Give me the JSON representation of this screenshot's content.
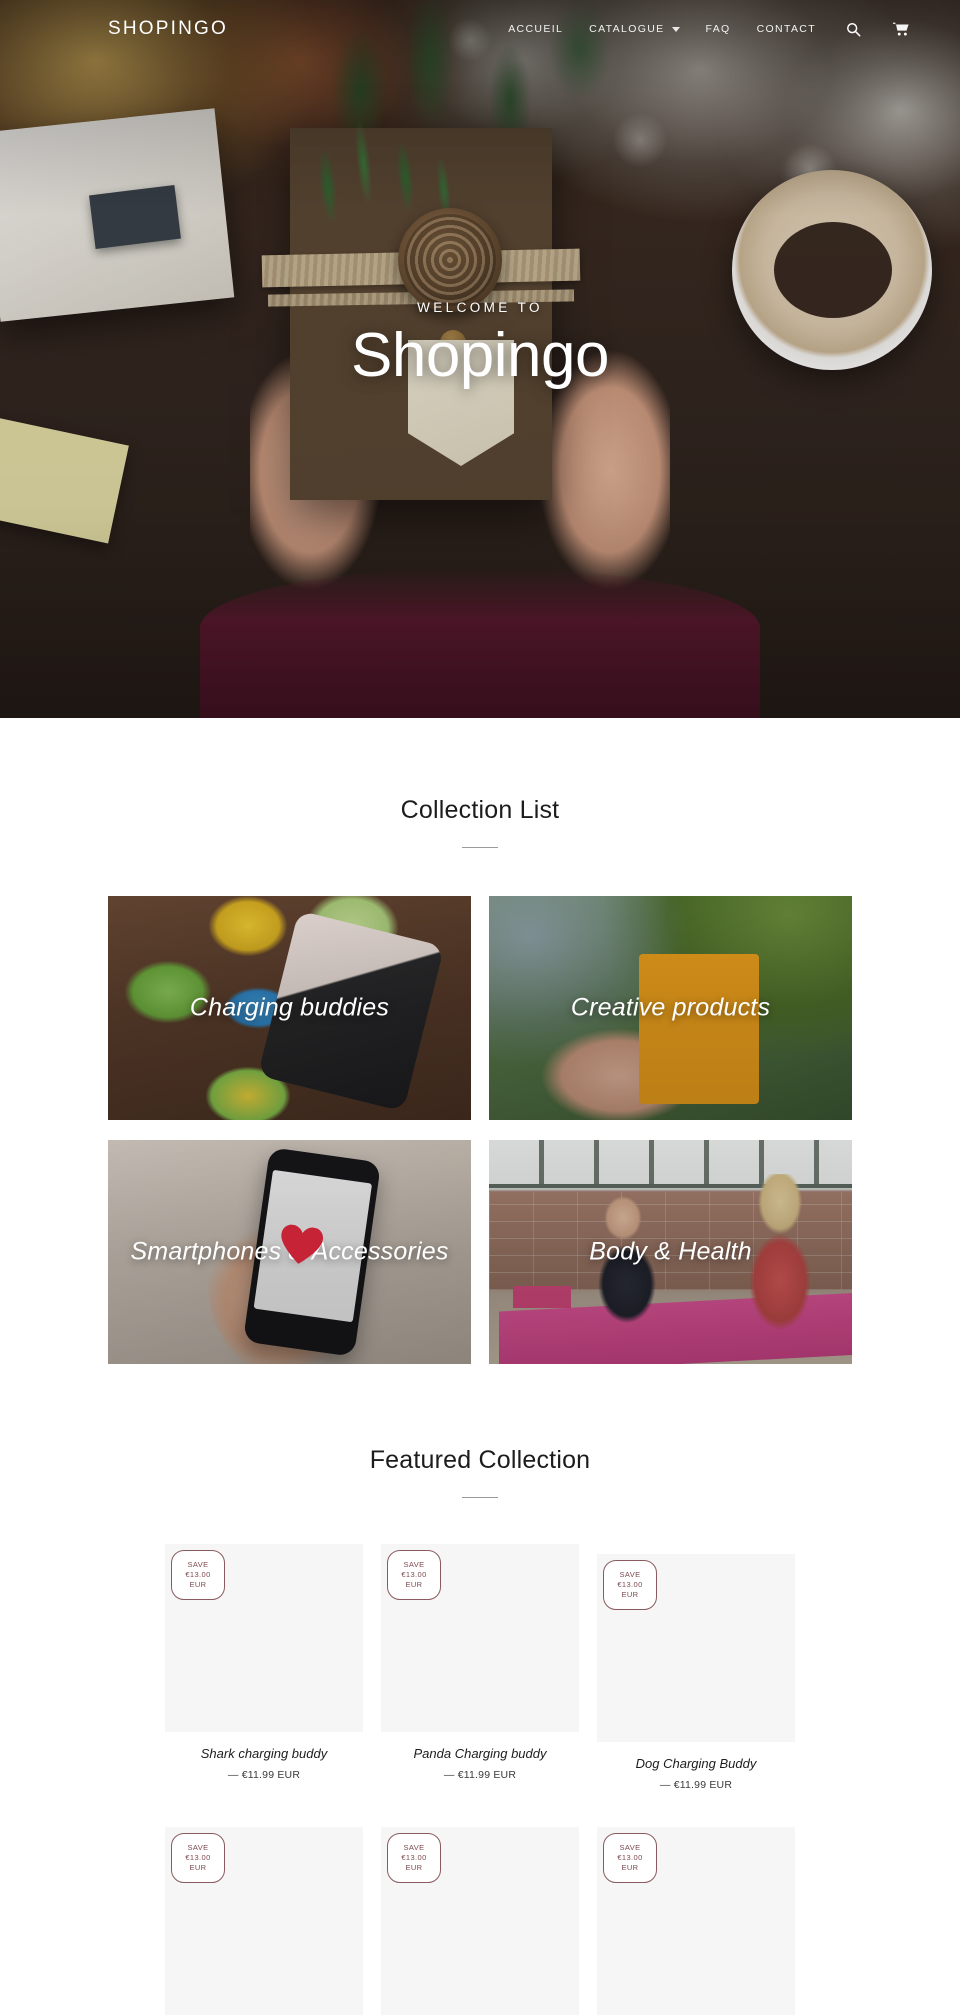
{
  "header": {
    "brand": "SHOPINGO",
    "nav": [
      {
        "label": "ACCUEIL",
        "has_dropdown": false
      },
      {
        "label": "CATALOGUE",
        "has_dropdown": true
      },
      {
        "label": "FAQ",
        "has_dropdown": false
      },
      {
        "label": "CONTACT",
        "has_dropdown": false
      }
    ],
    "search_icon": "search-icon",
    "cart_icon": "cart-icon"
  },
  "hero": {
    "kicker": "WELCOME TO",
    "title": "Shopingo"
  },
  "collection_section": {
    "title": "Collection List",
    "tiles": [
      {
        "label": "Charging buddies"
      },
      {
        "label": "Creative products"
      },
      {
        "label": "Smartphones & Accessories"
      },
      {
        "label": "Body & Health"
      }
    ]
  },
  "featured_section": {
    "title": "Featured Collection",
    "products": [
      {
        "badge_line1": "SAVE",
        "badge_line2": "€13.00",
        "badge_line3": "EUR",
        "title": "Shark charging buddy",
        "price": "— €11.99 EUR"
      },
      {
        "badge_line1": "SAVE",
        "badge_line2": "€13.00",
        "badge_line3": "EUR",
        "title": "Panda Charging buddy",
        "price": "— €11.99 EUR"
      },
      {
        "badge_line1": "SAVE",
        "badge_line2": "€13.00",
        "badge_line3": "EUR",
        "title": "Dog Charging Buddy",
        "price": "— €11.99 EUR"
      },
      {
        "badge_line1": "SAVE",
        "badge_line2": "€13.00",
        "badge_line3": "EUR",
        "title": "",
        "price": ""
      },
      {
        "badge_line1": "SAVE",
        "badge_line2": "€13.00",
        "badge_line3": "EUR",
        "title": "",
        "price": ""
      },
      {
        "badge_line1": "SAVE",
        "badge_line2": "€13.00",
        "badge_line3": "EUR",
        "title": "",
        "price": ""
      }
    ]
  },
  "colors": {
    "badge_border": "#8a5a5e",
    "badge_text": "#7e4b50",
    "heading_text": "#1c1c1c",
    "rule": "#9a9a9a",
    "product_media_bg": "#f6f6f6"
  }
}
